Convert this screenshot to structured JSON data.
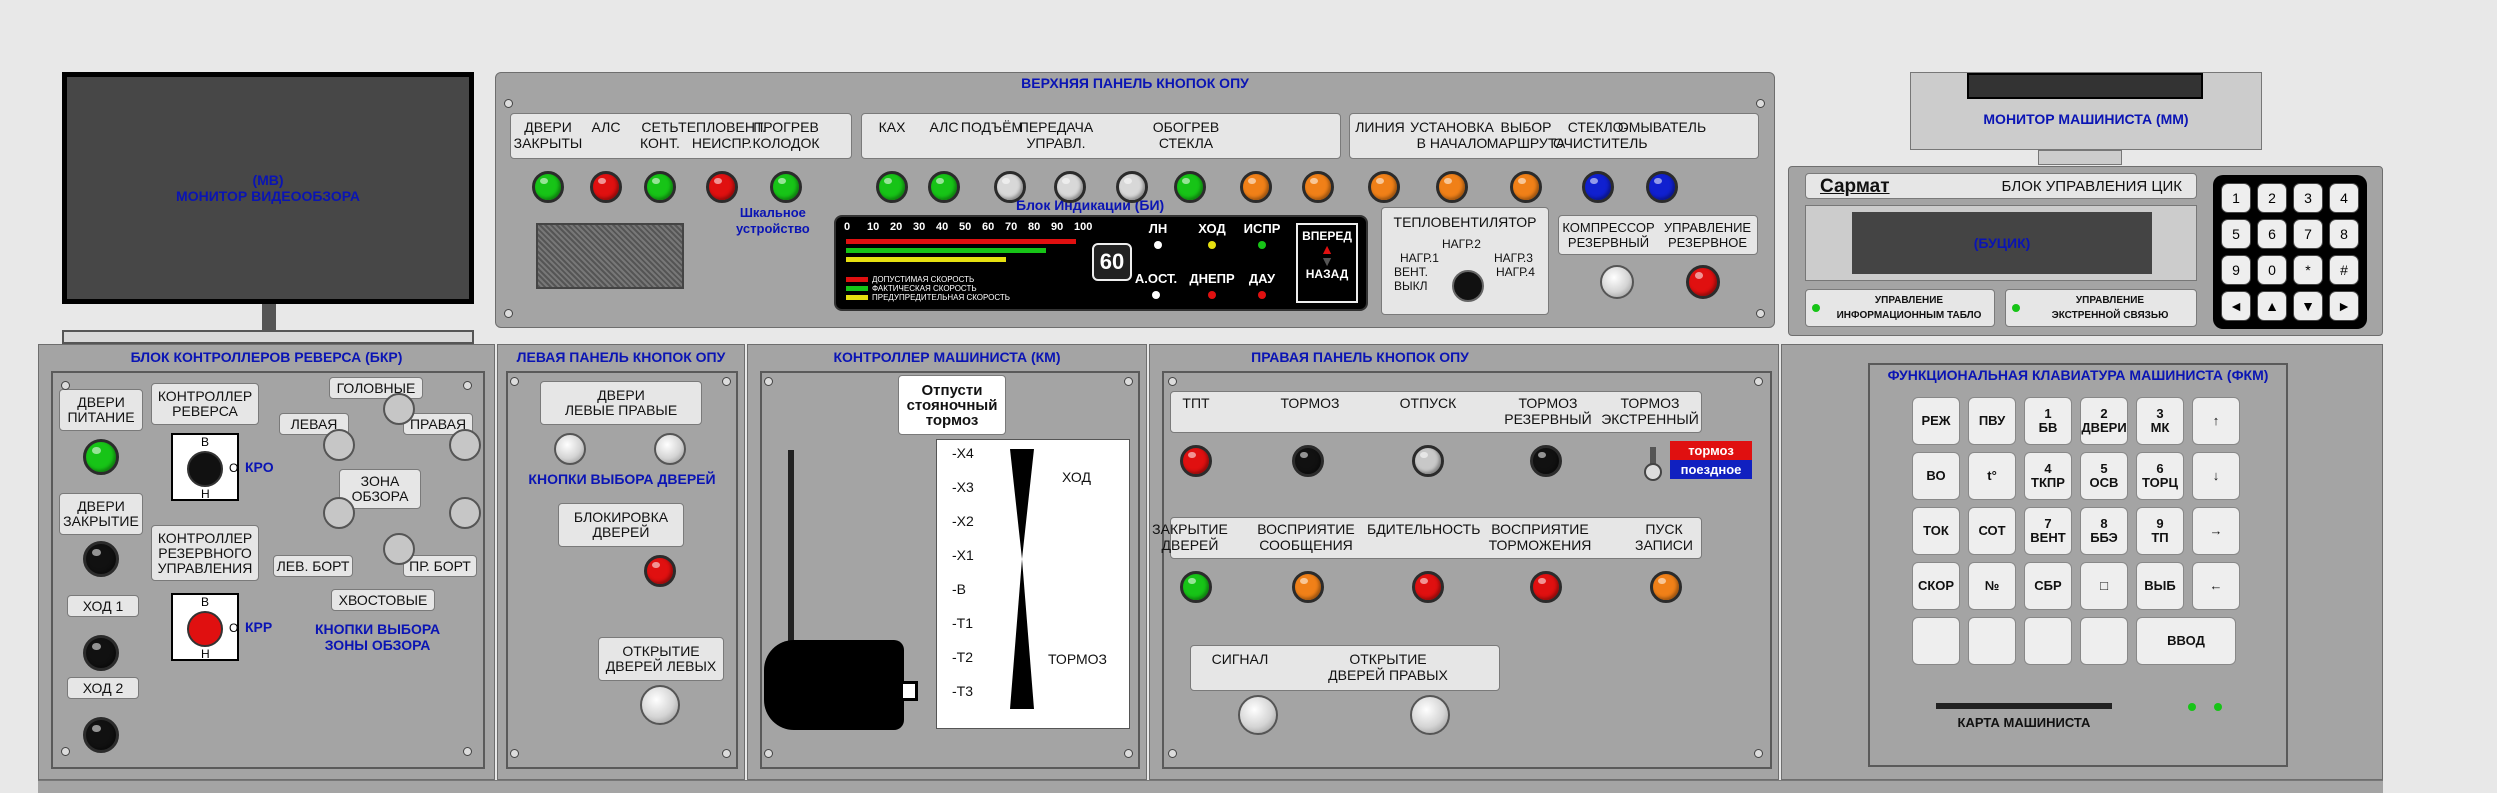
{
  "monitor_video": {
    "line1": "(МВ)",
    "line2": "МОНИТОР ВИДЕООБЗОРА"
  },
  "top_panel": {
    "title": "ВЕРХНЯЯ ПАНЕЛЬ КНОПОК ОПУ",
    "group1": [
      "ДВЕРИ\nЗАКРЫТЫ",
      "АЛС",
      "СЕТЬ\nКОНТ.",
      "ТЕПЛОВЕНТ.\nНЕИСПР.",
      "ПРОГРЕВ\nКОЛОДОК"
    ],
    "group2": [
      "КАХ",
      "АЛС",
      "ПОДЪЁМ",
      "ПЕРЕДАЧА\nУПРАВЛ.",
      "ОБОГРЕВ\nСТЕКЛА"
    ],
    "group3": [
      "ЛИНИЯ",
      "УСТАНОВКА\nВ НАЧАЛО",
      "ВЫБОР\nМАРШРУТА",
      "СТЕКЛО-\nОЧИСТИТЕЛЬ",
      "ОМЫВАТЕЛЬ"
    ],
    "led_colors": [
      "#17c417",
      "#e01010",
      "#17c417",
      "#e01010",
      "#17c417",
      "#17c417",
      "#17c417",
      "#d8d8d8",
      "#d8d8d8",
      "#d8d8d8",
      "#17c417",
      "#f08018",
      "#f08018",
      "#f08018",
      "#f08018",
      "#f08018",
      "#1020d0",
      "#1020d0"
    ],
    "scale_label": "Шкальное\nустройство",
    "bi_title": "Блок Индикации (БИ)",
    "bi_scale": [
      "0",
      "10",
      "20",
      "30",
      "40",
      "50",
      "60",
      "70",
      "80",
      "90",
      "100"
    ],
    "bi_legend": [
      "ДОПУСТИМАЯ СКОРОСТЬ",
      "ФАКТИЧЕСКАЯ СКОРОСТЬ",
      "ПРЕДУПРЕДИТЕЛЬНАЯ СКОРОСТЬ"
    ],
    "bi_speed": "60",
    "bi_ind": [
      "ЛН",
      "ХОД",
      "ИСПР",
      "А.ОСТ.",
      "ДНЕПР",
      "ДАУ"
    ],
    "bi_dir": [
      "ВПЕРЕД",
      "НАЗАД"
    ],
    "tv_title": "ТЕПЛОВЕНТИЛЯТОР",
    "tv_labels": [
      "НАГР.2",
      "НАГР.1",
      "НАГР.3",
      "ВЕНТ.",
      "НАГР.4",
      "ВЫКЛ"
    ],
    "comp_labels": [
      "КОМПРЕССОР\nРЕЗЕРВНЫЙ",
      "УПРАВЛЕНИЕ\nРЕЗЕРВНОЕ"
    ]
  },
  "monitor_mm": "МОНИТОР МАШИНИСТА (ММ)",
  "buцик": {
    "brand": "Сармат",
    "title": "БЛОК УПРАВЛЕНИЯ ЦИК",
    "display": "(БУЦИК)",
    "opt1": "УПРАВЛЕНИЕ\nИНФОРМАЦИОННЫМ ТАБЛО",
    "opt2": "УПРАВЛЕНИЕ\nЭКСТРЕННОЙ СВЯЗЬЮ",
    "keys": [
      "1",
      "2",
      "3",
      "4",
      "5",
      "6",
      "7",
      "8",
      "9",
      "0",
      "*",
      "#",
      "◄",
      "▲",
      "▼",
      "►"
    ]
  },
  "bkr": {
    "title": "БЛОК КОНТРОЛЛЕРОВ РЕВЕРСА (БКР)",
    "labels": [
      "ДВЕРИ\nПИТАНИЕ",
      "ДВЕРИ\nЗАКРЫТИЕ",
      "ХОД 1",
      "ХОД 2"
    ],
    "kr": "КОНТРОЛЛЕР\nРЕВЕРСА",
    "krr": "КОНТРОЛЛЕР\nРЕЗЕРВНОГО\nУПРАВЛЕНИЯ",
    "kro": "КРО",
    "krp": "КРР",
    "pos": [
      "В",
      "О",
      "Н"
    ],
    "zone": [
      "ГОЛОВНЫЕ",
      "ЛЕВАЯ",
      "ПРАВАЯ",
      "ЗОНА\nОБЗОРА",
      "ЛЕВ. БОРТ",
      "ПР. БОРТ",
      "ХВОСТОВЫЕ"
    ],
    "zone_caption": "КНОПКИ ВЫБОРА\nЗОНЫ ОБЗОРА"
  },
  "left_panel": {
    "title": "ЛЕВАЯ ПАНЕЛЬ КНОПОК ОПУ",
    "doors": "ДВЕРИ\nЛЕВЫЕ  ПРАВЫЕ",
    "doors_caption": "КНОПКИ ВЫБОРА ДВЕРЕЙ",
    "block": "БЛОКИРОВКА\nДВЕРЕЙ",
    "open": "ОТКРЫТИЕ\nДВЕРЕЙ ЛЕВЫХ"
  },
  "km": {
    "title": "КОНТРОЛЛЕР МАШИНИСТА (КМ)",
    "release": "Отпусти\nстояночный\nтормоз",
    "positions": [
      "-X4",
      "-X3",
      "-X2",
      "-X1",
      "-B",
      "-T1",
      "-T2",
      "-T3"
    ],
    "hod": "ХОД",
    "tormoz": "ТОРМОЗ"
  },
  "right_panel": {
    "title": "ПРАВАЯ ПАНЕЛЬ КНОПОК ОПУ",
    "row1": [
      "ТПТ",
      "ТОРМОЗ",
      "ОТПУСК",
      "ТОРМОЗ\nРЕЗЕРВНЫЙ",
      "ТОРМОЗ\nЭКСТРЕННЫЙ"
    ],
    "row2": [
      "ЗАКРЫТИЕ\nДВЕРЕЙ",
      "ВОСПРИЯТИЕ\nСООБЩЕНИЯ",
      "БДИТЕЛЬНОСТЬ",
      "ВОСПРИЯТИЕ\nТОРМОЖЕНИЯ",
      "ПУСК\nЗАПИСИ"
    ],
    "row3": [
      "СИГНАЛ",
      "ОТКРЫТИЕ\nДВЕРЕЙ ПРАВЫХ"
    ],
    "brake_tag": [
      "тормоз",
      "поездное"
    ]
  },
  "fkm": {
    "title": "ФУНКЦИОНАЛЬНАЯ КЛАВИАТУРА МАШИНИСТА (ФКМ)",
    "card": "КАРТА  МАШИНИСТА",
    "rows": [
      [
        "РЕЖ",
        "ПВУ",
        "1\nБВ",
        "2\nДВЕРИ",
        "3\nМК",
        "↑"
      ],
      [
        "ВО",
        "t°",
        "4\nТКПР",
        "5\nОСВ",
        "6\nТОРЦ",
        "↓"
      ],
      [
        "ТОК",
        "СОТ",
        "7\nВЕНТ",
        "8\nББЭ",
        "9\nТП",
        "→"
      ],
      [
        "СКОР",
        "№",
        "СБР",
        "□",
        "ВЫБ",
        "←"
      ],
      [
        "",
        "",
        "",
        "",
        "ВВОД"
      ]
    ]
  }
}
